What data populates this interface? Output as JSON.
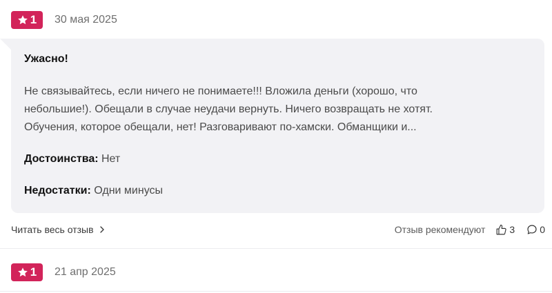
{
  "reviews": [
    {
      "rating": "1",
      "date": "30 мая 2025",
      "title": "Ужасно!",
      "text": "Не связывайтесь, если ничего не понимаете!!! Вложила деньги (хорошо, что\nнебольшие!). Обещали в случае неудачи вернуть. Ничего возвращать не хотят.\nОбучения, которое обещали, нет! Разговаривают по-хамски. Обманщики и...",
      "pros_label": "Достоинства:",
      "pros_value": "Нет",
      "cons_label": "Недостатки:",
      "cons_value": "Одни минусы",
      "read_more_label": "Читать весь отзыв",
      "recommend_label": "Отзыв рекомендуют",
      "likes": "3",
      "comments": "0"
    },
    {
      "rating": "1",
      "date": "21 апр 2025"
    }
  ],
  "colors": {
    "badge": "#d2245a",
    "bubble": "#f2f2f5"
  },
  "icons": {
    "star": "star-icon",
    "chevron": "chevron-right-icon",
    "thumb": "thumbs-up-icon",
    "comment": "comment-icon"
  }
}
